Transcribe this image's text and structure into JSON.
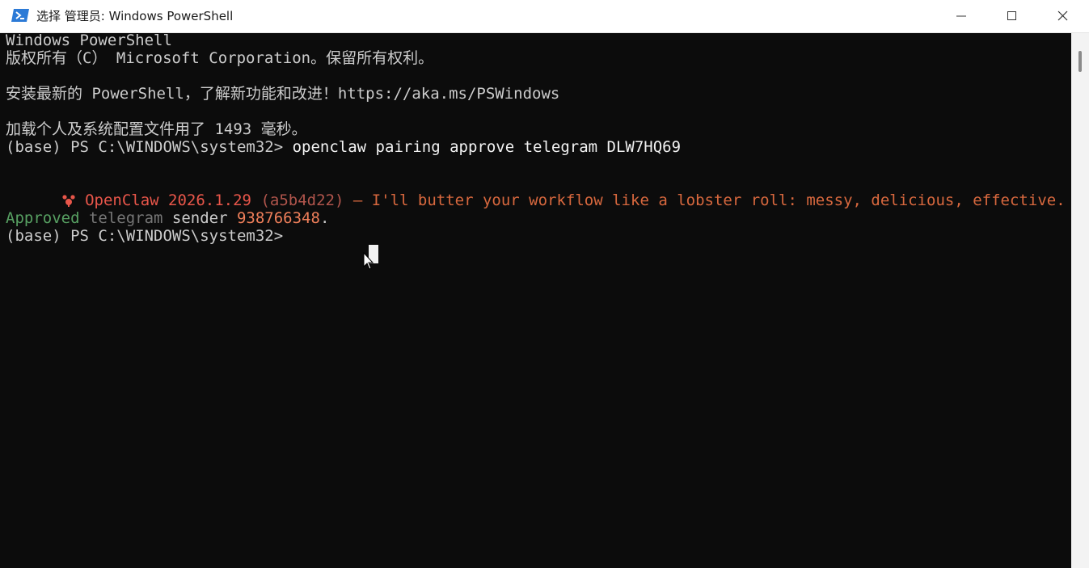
{
  "window": {
    "title": "选择 管理员: Windows PowerShell",
    "icon": "powershell-icon",
    "controls": [
      "minimize-icon",
      "maximize-icon",
      "close-icon"
    ]
  },
  "terminal": {
    "line1": "Windows PowerShell",
    "line2": "版权所有（C） Microsoft Corporation。保留所有权利。",
    "line3": "安装最新的 PowerShell，了解新功能和改进！https://aka.ms/PSWindows",
    "line4": "加载个人及系统配置文件用了 1493 毫秒。",
    "prompt1": "(base) PS C:\\WINDOWS\\system32> ",
    "command1": "openclaw pairing approve telegram DLW7HQ69",
    "banner": {
      "icon": "lobster-icon",
      "name": "OpenClaw 2026.1.29",
      "hash": " (a5b4d22)",
      "tagline": " — I'll butter your workflow like a lobster roll: messy, delicious, effective."
    },
    "result": {
      "status": "Approved",
      "channel": " telegram",
      "sender_label": " sender ",
      "sender_id": "938766348",
      "end": "."
    },
    "prompt2": "(base) PS C:\\WINDOWS\\system32>"
  },
  "colors": {
    "background": "#0c0c0c",
    "text": "#cccccc",
    "accent_red": "#e8564a",
    "approved_green": "#57a062"
  }
}
